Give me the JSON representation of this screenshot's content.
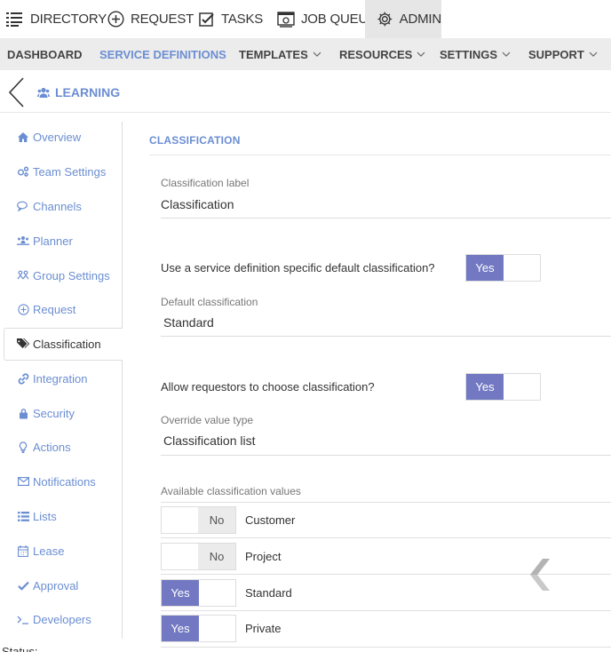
{
  "topnav": {
    "directory": "DIRECTORY",
    "request": "REQUEST",
    "tasks": "TASKS",
    "job_queue": "JOB QUEUE",
    "admin": "ADMIN"
  },
  "subnav": {
    "dashboard": "DASHBOARD",
    "service_definitions": "SERVICE DEFINITIONS",
    "templates": "TEMPLATES",
    "resources": "RESOURCES",
    "settings": "SETTINGS",
    "support": "SUPPORT"
  },
  "page": {
    "title": "LEARNING"
  },
  "sidebar": {
    "items": [
      {
        "label": "Overview",
        "icon": "home-icon"
      },
      {
        "label": "Team Settings",
        "icon": "cogs-icon"
      },
      {
        "label": "Channels",
        "icon": "comments-icon"
      },
      {
        "label": "Planner",
        "icon": "planner-icon"
      },
      {
        "label": "Group Settings",
        "icon": "group-icon"
      },
      {
        "label": "Request",
        "icon": "plus-circle-icon"
      },
      {
        "label": "Classification",
        "icon": "tags-icon"
      },
      {
        "label": "Integration",
        "icon": "link-icon"
      },
      {
        "label": "Security",
        "icon": "lock-icon"
      },
      {
        "label": "Actions",
        "icon": "lightbulb-icon"
      },
      {
        "label": "Notifications",
        "icon": "envelope-icon"
      },
      {
        "label": "Lists",
        "icon": "list-icon"
      },
      {
        "label": "Lease",
        "icon": "calendar-icon"
      },
      {
        "label": "Approval",
        "icon": "check-icon"
      },
      {
        "label": "Developers",
        "icon": "terminal-icon"
      }
    ]
  },
  "content": {
    "section_title": "CLASSIFICATION",
    "classification_label": {
      "label": "Classification label",
      "value": "Classification"
    },
    "use_specific_default": {
      "question": "Use a service definition specific default classification?",
      "value": "Yes"
    },
    "default_classification": {
      "label": "Default classification",
      "value": "Standard"
    },
    "allow_choose": {
      "question": "Allow requestors to choose classification?",
      "value": "Yes"
    },
    "override_value_type": {
      "label": "Override value type",
      "value": "Classification list"
    },
    "available_values": {
      "label": "Available classification values",
      "items": [
        {
          "name": "Customer",
          "enabled": "No"
        },
        {
          "name": "Project",
          "enabled": "No"
        },
        {
          "name": "Standard",
          "enabled": "Yes"
        },
        {
          "name": "Private",
          "enabled": "Yes"
        }
      ]
    }
  },
  "status": {
    "label": "Status:"
  },
  "colors": {
    "accent": "#6b8ed2",
    "toggle_on": "#7279c2",
    "subnav_bg": "#ececec"
  }
}
